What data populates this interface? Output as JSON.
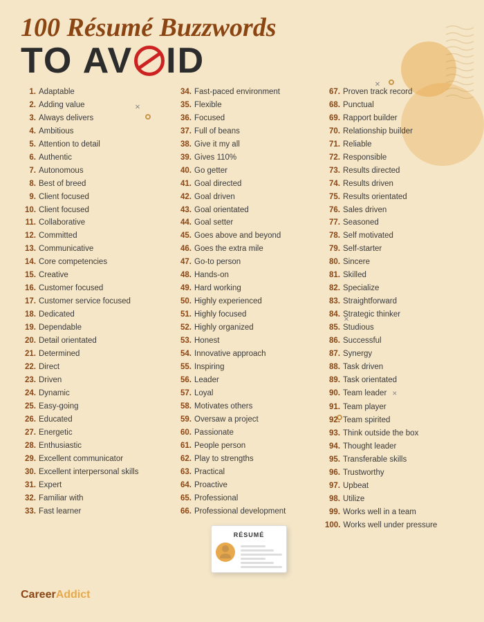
{
  "header": {
    "title_line1": "100 Résumé Buzzwords",
    "title_line2_pre": "TO AV",
    "title_line2_post": "ID",
    "avoid_label": "TO AVOID"
  },
  "columns": {
    "left": [
      {
        "num": "1.",
        "text": "Adaptable"
      },
      {
        "num": "2.",
        "text": "Adding value"
      },
      {
        "num": "3.",
        "text": "Always delivers"
      },
      {
        "num": "4.",
        "text": "Ambitious"
      },
      {
        "num": "5.",
        "text": "Attention to detail"
      },
      {
        "num": "6.",
        "text": "Authentic"
      },
      {
        "num": "7.",
        "text": "Autonomous"
      },
      {
        "num": "8.",
        "text": "Best of breed"
      },
      {
        "num": "9.",
        "text": "Client focused"
      },
      {
        "num": "10.",
        "text": "Client focused"
      },
      {
        "num": "11.",
        "text": "Collaborative"
      },
      {
        "num": "12.",
        "text": "Committed"
      },
      {
        "num": "13.",
        "text": "Communicative"
      },
      {
        "num": "14.",
        "text": "Core competencies"
      },
      {
        "num": "15.",
        "text": "Creative"
      },
      {
        "num": "16.",
        "text": "Customer focused"
      },
      {
        "num": "17.",
        "text": "Customer service focused"
      },
      {
        "num": "18.",
        "text": "Dedicated"
      },
      {
        "num": "19.",
        "text": "Dependable"
      },
      {
        "num": "20.",
        "text": "Detail orientated"
      },
      {
        "num": "21.",
        "text": "Determined"
      },
      {
        "num": "22.",
        "text": "Direct"
      },
      {
        "num": "23.",
        "text": "Driven"
      },
      {
        "num": "24.",
        "text": "Dynamic"
      },
      {
        "num": "25.",
        "text": "Easy-going"
      },
      {
        "num": "26.",
        "text": "Educated"
      },
      {
        "num": "27.",
        "text": "Energetic"
      },
      {
        "num": "28.",
        "text": "Enthusiastic"
      },
      {
        "num": "29.",
        "text": "Excellent communicator"
      },
      {
        "num": "30.",
        "text": "Excellent interpersonal skills"
      },
      {
        "num": "31.",
        "text": "Expert"
      },
      {
        "num": "32.",
        "text": "Familiar with"
      },
      {
        "num": "33.",
        "text": "Fast learner"
      }
    ],
    "middle": [
      {
        "num": "34.",
        "text": "Fast-paced environment"
      },
      {
        "num": "35.",
        "text": "Flexible"
      },
      {
        "num": "36.",
        "text": "Focused"
      },
      {
        "num": "37.",
        "text": "Full of beans"
      },
      {
        "num": "38.",
        "text": "Give it my all"
      },
      {
        "num": "39.",
        "text": "Gives 110%"
      },
      {
        "num": "40.",
        "text": "Go getter"
      },
      {
        "num": "41.",
        "text": "Goal directed"
      },
      {
        "num": "42.",
        "text": "Goal driven"
      },
      {
        "num": "43.",
        "text": "Goal orientated"
      },
      {
        "num": "44.",
        "text": "Goal setter"
      },
      {
        "num": "45.",
        "text": "Goes above and beyond"
      },
      {
        "num": "46.",
        "text": "Goes the extra mile"
      },
      {
        "num": "47.",
        "text": "Go-to person"
      },
      {
        "num": "48.",
        "text": "Hands-on"
      },
      {
        "num": "49.",
        "text": "Hard working"
      },
      {
        "num": "50.",
        "text": "Highly experienced"
      },
      {
        "num": "51.",
        "text": "Highly focused"
      },
      {
        "num": "52.",
        "text": "Highly organized"
      },
      {
        "num": "53.",
        "text": "Honest"
      },
      {
        "num": "54.",
        "text": "Innovative approach"
      },
      {
        "num": "55.",
        "text": "Inspiring"
      },
      {
        "num": "56.",
        "text": "Leader"
      },
      {
        "num": "57.",
        "text": "Loyal"
      },
      {
        "num": "58.",
        "text": "Motivates others"
      },
      {
        "num": "59.",
        "text": "Oversaw a project"
      },
      {
        "num": "60.",
        "text": "Passionate"
      },
      {
        "num": "61.",
        "text": "People person"
      },
      {
        "num": "62.",
        "text": "Play to strengths"
      },
      {
        "num": "63.",
        "text": "Practical"
      },
      {
        "num": "64.",
        "text": "Proactive"
      },
      {
        "num": "65.",
        "text": "Professional"
      },
      {
        "num": "66.",
        "text": "Professional development"
      }
    ],
    "right": [
      {
        "num": "67.",
        "text": "Proven track record"
      },
      {
        "num": "68.",
        "text": "Punctual"
      },
      {
        "num": "69.",
        "text": "Rapport builder"
      },
      {
        "num": "70.",
        "text": "Relationship builder"
      },
      {
        "num": "71.",
        "text": "Reliable"
      },
      {
        "num": "72.",
        "text": "Responsible"
      },
      {
        "num": "73.",
        "text": "Results directed"
      },
      {
        "num": "74.",
        "text": "Results driven"
      },
      {
        "num": "75.",
        "text": "Results orientated"
      },
      {
        "num": "76.",
        "text": "Sales driven"
      },
      {
        "num": "77.",
        "text": "Seasoned"
      },
      {
        "num": "78.",
        "text": "Self motivated"
      },
      {
        "num": "79.",
        "text": "Self-starter"
      },
      {
        "num": "80.",
        "text": "Sincere"
      },
      {
        "num": "81.",
        "text": "Skilled"
      },
      {
        "num": "82.",
        "text": "Specialize"
      },
      {
        "num": "83.",
        "text": "Straightforward"
      },
      {
        "num": "84.",
        "text": "Strategic thinker"
      },
      {
        "num": "85.",
        "text": "Studious"
      },
      {
        "num": "86.",
        "text": "Successful"
      },
      {
        "num": "87.",
        "text": "Synergy"
      },
      {
        "num": "88.",
        "text": "Task driven"
      },
      {
        "num": "89.",
        "text": "Task orientated"
      },
      {
        "num": "90.",
        "text": "Team leader"
      },
      {
        "num": "91.",
        "text": "Team player"
      },
      {
        "num": "92.",
        "text": "Team spirited"
      },
      {
        "num": "93.",
        "text": "Think outside the box"
      },
      {
        "num": "94.",
        "text": "Thought leader"
      },
      {
        "num": "95.",
        "text": "Transferable skills"
      },
      {
        "num": "96.",
        "text": "Trustworthy"
      },
      {
        "num": "97.",
        "text": "Upbeat"
      },
      {
        "num": "98.",
        "text": "Utilize"
      },
      {
        "num": "99.",
        "text": "Works well in a team"
      },
      {
        "num": "100.",
        "text": "Works well under pressure"
      }
    ]
  },
  "resume_card": {
    "label": "RÉSUMÉ"
  },
  "brand": {
    "name": "CareerAddict",
    "dot_color": "#e8a84c"
  },
  "decorations": {
    "x_symbol": "×",
    "circle_symbol": "○"
  }
}
